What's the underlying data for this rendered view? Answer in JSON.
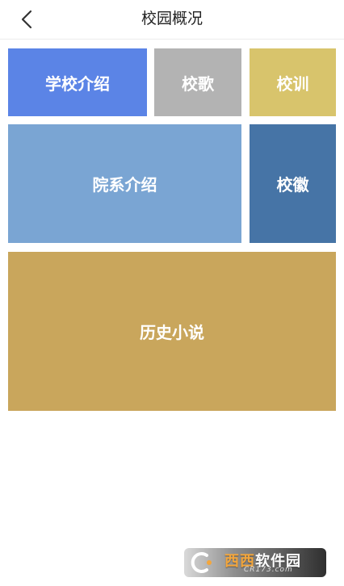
{
  "header": {
    "title": "校园概况",
    "back_icon": "chevron-left-icon"
  },
  "tiles": [
    {
      "label": "学校介绍",
      "color": "#5b84e6"
    },
    {
      "label": "校歌",
      "color": "#b3b3b3"
    },
    {
      "label": "校训",
      "color": "#d8c46c"
    },
    {
      "label": "院系介绍",
      "color": "#7aa5d3"
    },
    {
      "label": "校徽",
      "color": "#4674a6"
    },
    {
      "label": "历史小说",
      "color": "#c9a65c"
    }
  ],
  "watermark": {
    "brand_accent": "西西",
    "brand_rest": "软件园",
    "domain": "CR173.com"
  }
}
